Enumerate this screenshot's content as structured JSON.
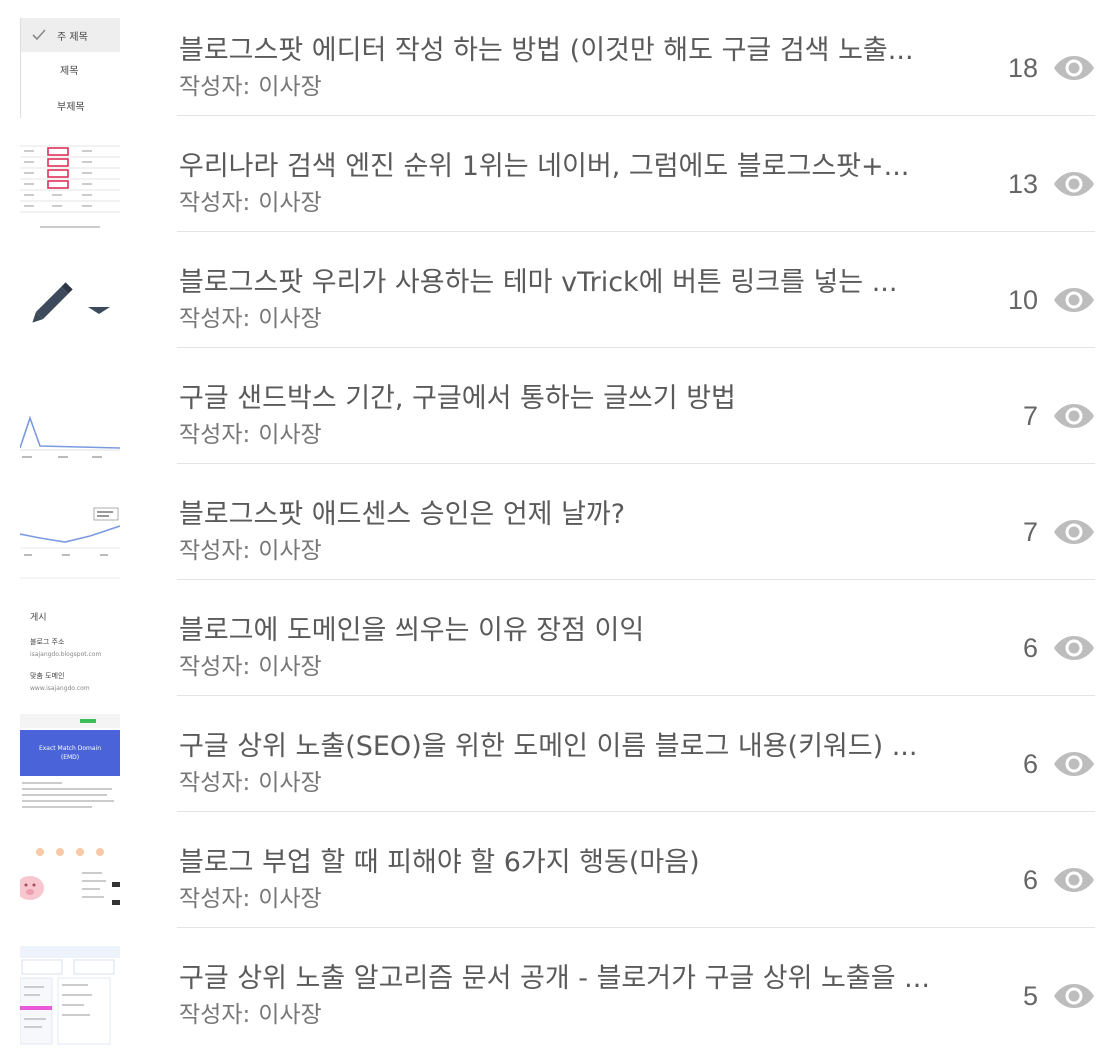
{
  "posts": [
    {
      "title": "블로그스팟 에디터 작성 하는 방법 (이것만 해도 구글 검색 노출...",
      "author_label": "작성자:",
      "author": "이사장",
      "views": "18",
      "thumb": {
        "type": "dropdown",
        "items": [
          "주 제목",
          "제목",
          "부제목"
        ]
      }
    },
    {
      "title": "우리나라 검색 엔진 순위 1위는 네이버, 그럼에도 블로그스팟+...",
      "author_label": "작성자:",
      "author": "이사장",
      "views": "13",
      "thumb": {
        "type": "table"
      }
    },
    {
      "title": "블로그스팟 우리가 사용하는 테마 vTrick에 버튼 링크를 넣는 ...",
      "author_label": "작성자:",
      "author": "이사장",
      "views": "10",
      "thumb": {
        "type": "pencil"
      }
    },
    {
      "title": "구글 샌드박스 기간, 구글에서 통하는 글쓰기 방법",
      "author_label": "작성자:",
      "author": "이사장",
      "views": "7",
      "thumb": {
        "type": "spike-chart"
      }
    },
    {
      "title": "블로그스팟 애드센스 승인은 언제 날까?",
      "author_label": "작성자:",
      "author": "이사장",
      "views": "7",
      "thumb": {
        "type": "wave-chart"
      }
    },
    {
      "title": "블로그에 도메인을 씌우는 이유 장점 이익",
      "author_label": "작성자:",
      "author": "이사장",
      "views": "6",
      "thumb": {
        "type": "settings",
        "items": [
          "게시",
          "블로그 주소",
          "isajangdo.blogspot.com",
          "맞춤 도메인",
          "www.isajangdo.com"
        ]
      }
    },
    {
      "title": "구글 상위 노출(SEO)을 위한 도메인 이름 블로그 내용(키워드) ...",
      "author_label": "작성자:",
      "author": "이사장",
      "views": "6",
      "thumb": {
        "type": "banner",
        "items": [
          "Exact Match Domain",
          "(EMD)"
        ]
      }
    },
    {
      "title": "블로그 부업 할 때 피해야 할 6가지 행동(마음)",
      "author_label": "작성자:",
      "author": "이사장",
      "views": "6",
      "thumb": {
        "type": "illustration"
      }
    },
    {
      "title": "구글 상위 노출 알고리즘 문서 공개 - 블로거가 구글 상위 노출을 ...",
      "author_label": "작성자:",
      "author": "이사장",
      "views": "5",
      "thumb": {
        "type": "dashboard"
      }
    }
  ],
  "icons": {
    "views": "eye-icon"
  },
  "colors": {
    "text": "#5a5a5a",
    "muted": "#777777",
    "icon": "#bdbdbd",
    "divider": "#e3e3e3",
    "chart": "#7b9be0"
  }
}
